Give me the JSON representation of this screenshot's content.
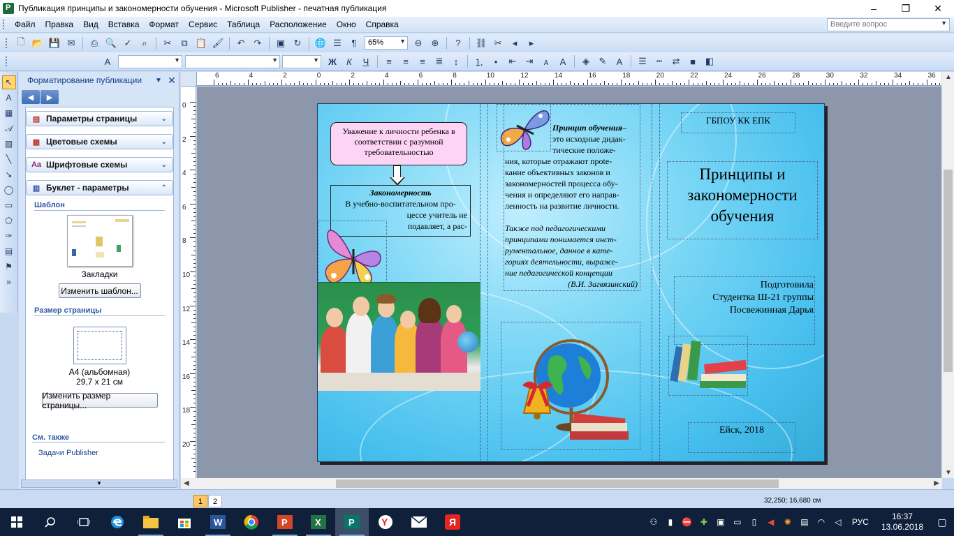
{
  "window": {
    "title": "Публикация принципы и закономерности обучения - Microsoft Publisher - печатная публикация",
    "minimize": "–",
    "maximize": "❐",
    "close": "✕"
  },
  "menu": [
    "Файл",
    "Правка",
    "Вид",
    "Вставка",
    "Формат",
    "Сервис",
    "Таблица",
    "Расположение",
    "Окно",
    "Справка"
  ],
  "help_placeholder": "Введите вопрос",
  "toolbar": {
    "zoom": "65%"
  },
  "taskpane": {
    "title": "Форматирование публикации",
    "sections": [
      {
        "label": "Параметры страницы",
        "icon": "page-setup-icon"
      },
      {
        "label": "Цветовые схемы",
        "icon": "color-scheme-icon"
      },
      {
        "label": "Шрифтовые схемы",
        "icon": "font-scheme-icon"
      },
      {
        "label": "Буклет - параметры",
        "icon": "brochure-icon"
      }
    ],
    "template_heading": "Шаблон",
    "template_name": "Закладки",
    "change_template": "Изменить шаблон...",
    "pagesize_heading": "Размер страницы",
    "pagesize_name": "A4 (альбомная)",
    "pagesize_dims": "29,7 x 21 см",
    "change_pagesize": "Изменить размер страницы...",
    "see_also_heading": "См. также",
    "see_also_link": "Задачи Publisher"
  },
  "rulers": {
    "horizontal": [
      "6",
      "4",
      "2",
      "0",
      "2",
      "4",
      "6",
      "8",
      "10",
      "12",
      "14",
      "16",
      "18",
      "20",
      "22",
      "24",
      "26",
      "28",
      "30",
      "32",
      "34",
      "36"
    ],
    "vertical": [
      "0",
      "2",
      "4",
      "6",
      "8",
      "10",
      "12",
      "14",
      "16",
      "18",
      "20"
    ]
  },
  "brochure": {
    "callout": "Уважение к личности ребенка в соответствии с разумной требовательностью",
    "law_title": "Закономерность",
    "law_line1": "В учебно-воспитательном про-",
    "law_line2": "цессе учитель не",
    "law_line3": "подавляет, а рас-",
    "principle_title": "Принцип обучения",
    "principle_dash": "–",
    "principle_lines": [
      "это исходные дидак-",
      "тические положе-",
      "ния, которые отражают прote-",
      "кание объективных законов и",
      "закономерностей процесса обу-",
      "чения и определяют его направ-",
      "ленность на развитие личности."
    ],
    "quote_lines": [
      "Также под педагогическими",
      "принципами понимается инст-",
      "рументальное, данное в кате-",
      "гориях деятельности, выраже-",
      "ние педагогической концепции"
    ],
    "quote_author": "(В.И. Загвязинский)",
    "org": "ГБПОУ КК ЕПК",
    "main_title": "Принципы и закономерности обучения",
    "author_l1": "Подготовила",
    "author_l2": "Студентка Ш-21 группы",
    "author_l3": "Посвежинная Дарья",
    "city": "Ейск, 2018"
  },
  "status": {
    "pages": [
      "1",
      "2"
    ],
    "coords": "32,250; 16,680 см"
  },
  "taskbar": {
    "lang": "РУС",
    "time": "16:37",
    "date": "13.06.2018"
  }
}
